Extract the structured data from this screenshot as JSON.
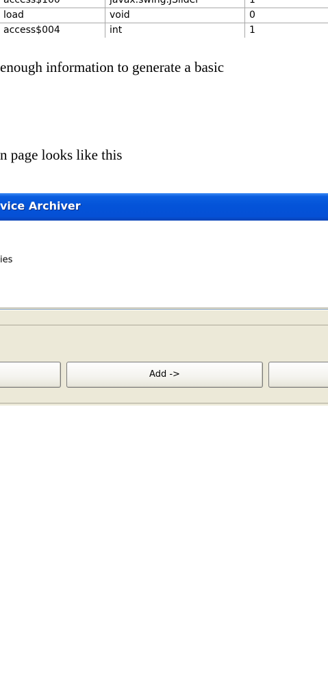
{
  "table": {
    "rows": [
      [
        "access$100",
        "javax.swing.JSlider",
        "1"
      ],
      [
        "load",
        "void",
        "0"
      ],
      [
        "access$004",
        "int",
        "1"
      ]
    ]
  },
  "document": {
    "line1": "enough information to generate a basic",
    "line2": "n page looks like this"
  },
  "dialog": {
    "title": "vice Archiver",
    "properties_label": "ies",
    "add_button_label": "Add ->",
    "left_button_label": "",
    "right_button_label": ""
  }
}
